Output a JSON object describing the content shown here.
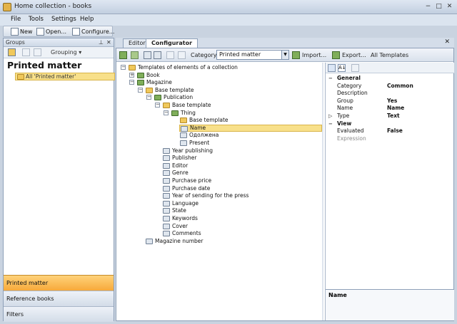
{
  "window": {
    "title": "Home collection - books",
    "minimize": "−",
    "maximize": "□",
    "close": "✕"
  },
  "menu": [
    "File",
    "Tools",
    "Settings",
    "Help"
  ],
  "toolbar": {
    "new_label": "New",
    "open_label": "Open...",
    "configure_label": "Configure..."
  },
  "groups_panel": {
    "header": "Groups",
    "pin": "⊥",
    "close": "✕",
    "grouping_label": "Grouping",
    "grouping_arrow": "▾",
    "title": "Printed matter",
    "all_item": "All 'Printed matter'"
  },
  "nav_buttons": [
    "Printed matter",
    "Reference books",
    "Filters"
  ],
  "tabs": {
    "editor": "Editor",
    "configurator": "Configurator",
    "close": "✕"
  },
  "config_toolbar": {
    "category_label": "Category",
    "category_value": "Printed matter",
    "import_label": "Import...",
    "export_label": "Export...",
    "all_templates_label": "All Templates",
    "dropdown_arrow": "▼"
  },
  "tree": [
    {
      "label": "Templates of elements of a collection",
      "expander": "−",
      "icon": "folder"
    },
    {
      "label": "Book",
      "expander": "+",
      "icon": "template"
    },
    {
      "label": "Magazine",
      "expander": "−",
      "icon": "template"
    },
    {
      "label": "Base template",
      "expander": "−",
      "icon": "folder"
    },
    {
      "label": "Publication",
      "expander": "−",
      "icon": "template"
    },
    {
      "label": "Base template",
      "expander": "−",
      "icon": "folder"
    },
    {
      "label": "Thing",
      "expander": "−",
      "icon": "template"
    },
    {
      "label": "Base template",
      "icon": "folder"
    },
    {
      "label": "Name",
      "icon": "element",
      "selected": true
    },
    {
      "label": "Одолжена",
      "icon": "element"
    },
    {
      "label": "Present",
      "icon": "element"
    },
    {
      "label": "Year publishing",
      "icon": "element"
    },
    {
      "label": "Publisher",
      "icon": "element"
    },
    {
      "label": "Editor",
      "icon": "element"
    },
    {
      "label": "Genre",
      "icon": "element"
    },
    {
      "label": "Purchase price",
      "icon": "element"
    },
    {
      "label": "Purchase date",
      "icon": "element"
    },
    {
      "label": "Year of sending for the press",
      "icon": "element"
    },
    {
      "label": "Language",
      "icon": "element"
    },
    {
      "label": "State",
      "icon": "element"
    },
    {
      "label": "Keywords",
      "icon": "element"
    },
    {
      "label": "Cover",
      "icon": "element"
    },
    {
      "label": "Comments",
      "icon": "element"
    },
    {
      "label": "Magazine number",
      "icon": "element"
    }
  ],
  "properties": {
    "sort_alpha": "A↓",
    "rows": [
      {
        "type": "category",
        "key": "General",
        "expander": "−"
      },
      {
        "key": "Category",
        "value": "Common"
      },
      {
        "key": "Description",
        "value": ""
      },
      {
        "key": "Group",
        "value": "Yes"
      },
      {
        "key": "Name",
        "value": "Name"
      },
      {
        "key": "Type",
        "value": "Text",
        "expander": "▷"
      },
      {
        "type": "category",
        "key": "View",
        "expander": "−"
      },
      {
        "key": "Evaluated",
        "value": "False"
      },
      {
        "key": "Expression",
        "value": "",
        "disabled": true
      }
    ],
    "description_title": "Name"
  }
}
